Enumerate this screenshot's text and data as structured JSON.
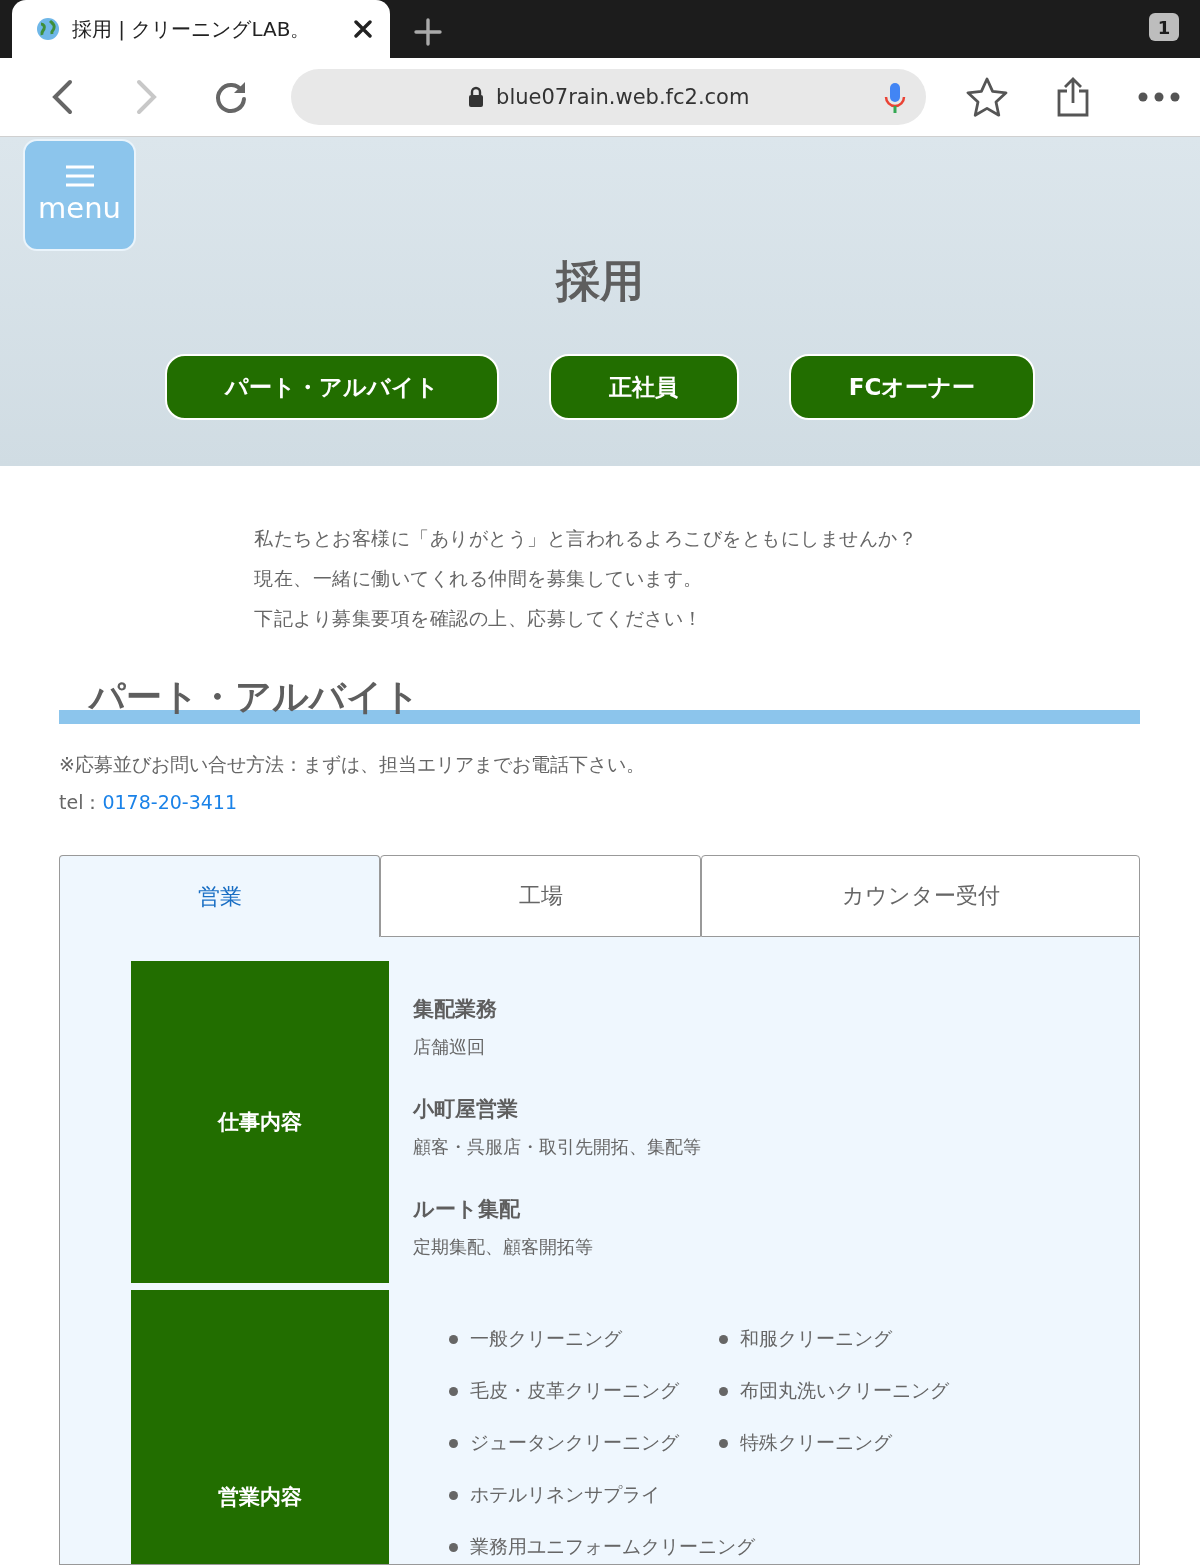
{
  "browser": {
    "tab_title": "採用 | クリーニングLAB。",
    "tab_count": "1",
    "url": "blue07rain.web.fc2.com",
    "forward_disabled": true
  },
  "header": {
    "menu_label": "menu",
    "title": "採用",
    "buttons": [
      "パート・アルバイト",
      "正社員",
      "FCオーナー"
    ]
  },
  "intro": [
    "私たちとお客様に「ありがとう」と言われるよろこびをともにしませんか？",
    "現在、一緒に働いてくれる仲間を募集しています。",
    "下記より募集要項を確認の上、応募してください！"
  ],
  "section": {
    "heading": "パート・アルバイト",
    "note": "※応募並びお問い合せ方法：まずは、担当エリアまでお電話下さい。",
    "tel_label": "tel：",
    "tel_number": "0178-20-3411",
    "tabs": [
      {
        "label": "営業",
        "selected": true
      },
      {
        "label": "工場",
        "selected": false
      },
      {
        "label": "カウンター受付",
        "selected": false
      }
    ],
    "rows": [
      {
        "kind": "jobs",
        "label": "仕事内容",
        "jobs": [
          {
            "title": "集配業務",
            "detail": "店舗巡回"
          },
          {
            "title": "小町屋営業",
            "detail": "顧客・呉服店・取引先開拓、集配等"
          },
          {
            "title": "ルート集配",
            "detail": "定期集配、顧客開拓等"
          }
        ]
      },
      {
        "kind": "list",
        "label": "営業内容",
        "items": [
          "一般クリーニング",
          "和服クリーニング",
          "毛皮・皮革クリーニング",
          "布団丸洗いクリーニング",
          "ジュータンクリーニング",
          "特殊クリーニング",
          "ホテルリネンサプライ",
          "業務用ユニフォームクリーニング"
        ]
      }
    ]
  }
}
